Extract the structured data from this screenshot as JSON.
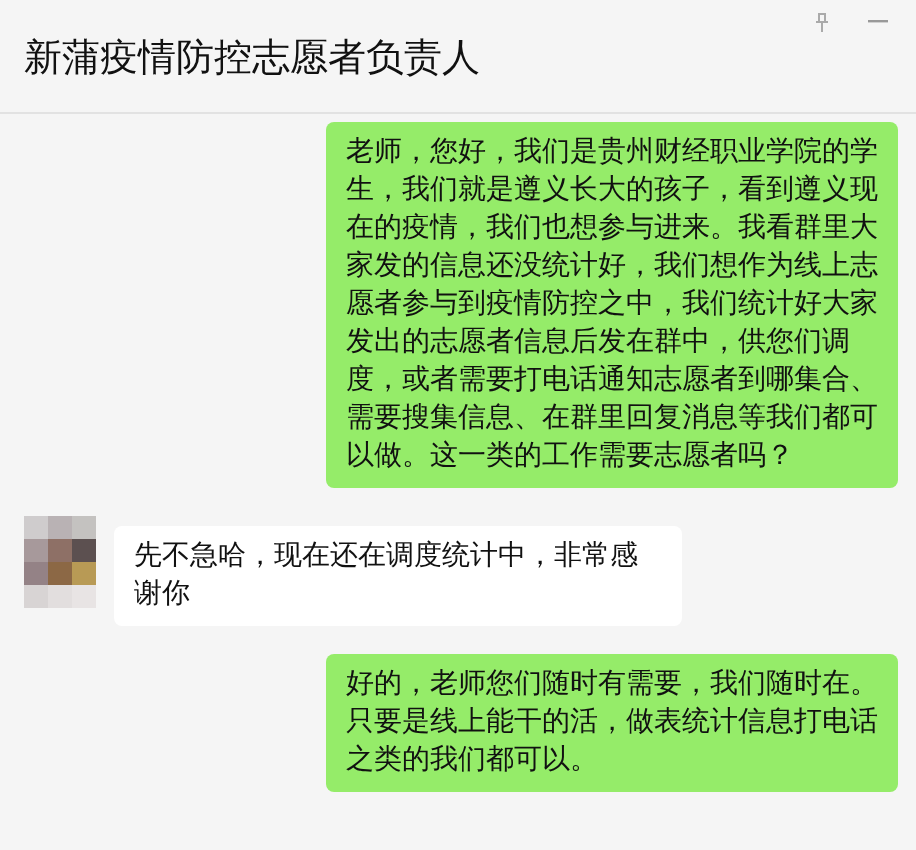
{
  "window": {
    "title": "新蒲疫情防控志愿者负责人"
  },
  "messages": [
    {
      "kind": "sent",
      "text": "老师，您好，我们是贵州财经职业学院的学生，我们就是遵义长大的孩子，看到遵义现在的疫情，我们也想参与进来。我看群里大家发的信息还没统计好，我们想作为线上志愿者参与到疫情防控之中，我们统计好大家发出的志愿者信息后发在群中，供您们调度，或者需要打电话通知志愿者到哪集合、需要搜集信息、在群里回复消息等我们都可以做。这一类的工作需要志愿者吗？"
    },
    {
      "kind": "received",
      "text": "先不急哈，现在还在调度统计中，非常感谢你"
    },
    {
      "kind": "sent",
      "text": "好的，老师您们随时有需要，我们随时在。只要是线上能干的活，做表统计信息打电话之类的我们都可以。"
    }
  ]
}
